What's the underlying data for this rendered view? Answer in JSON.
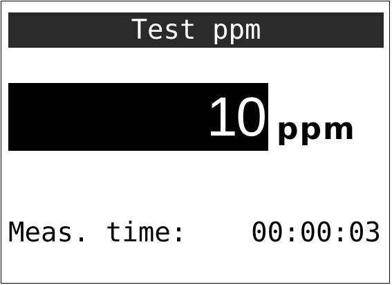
{
  "header": {
    "title": "Test ppm"
  },
  "reading": {
    "value": "10",
    "unit": "ppm"
  },
  "measurement": {
    "label": "Meas. time:",
    "time": "00:00:03"
  },
  "colors": {
    "title_bar_bg": "#2a2a2a",
    "value_bg": "#000000",
    "text_light": "#ffffff",
    "text_dark": "#000000"
  }
}
